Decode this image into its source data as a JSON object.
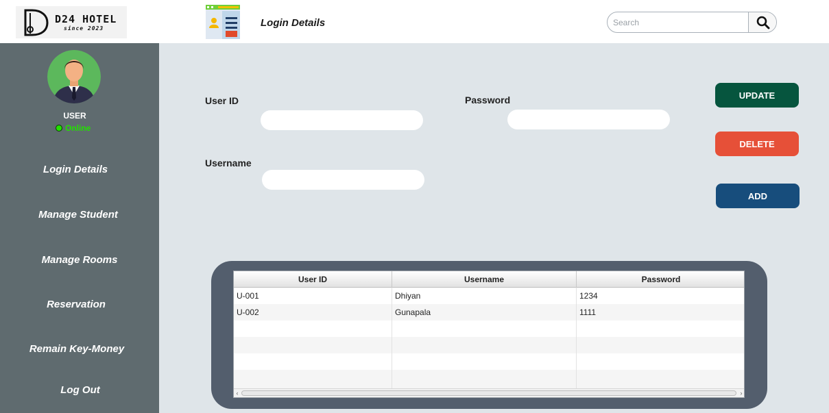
{
  "brand": {
    "name": "D24 HOTEL",
    "tagline": "since 2023"
  },
  "header": {
    "title": "Login Details",
    "search": {
      "placeholder": "Search",
      "value": ""
    }
  },
  "sidebar": {
    "user_label": "USER",
    "status": "Online",
    "items": [
      {
        "label": "Login Details"
      },
      {
        "label": "Manage Student"
      },
      {
        "label": "Manage Rooms"
      },
      {
        "label": "Reservation"
      },
      {
        "label": "Remain Key-Money"
      },
      {
        "label": "Log Out"
      }
    ]
  },
  "form": {
    "user_id": {
      "label": "User ID",
      "value": ""
    },
    "password": {
      "label": "Password",
      "value": ""
    },
    "username": {
      "label": "Username",
      "value": ""
    }
  },
  "buttons": {
    "update": "UPDATE",
    "delete": "DELETE",
    "add": "ADD"
  },
  "colors": {
    "update": "#06553e",
    "delete": "#e65038",
    "add": "#174d7c",
    "sidebar": "#5f6b6f",
    "status": "#22e000"
  },
  "table": {
    "columns": [
      "User ID",
      "Username",
      "Password"
    ],
    "rows": [
      [
        "U-001",
        "Dhiyan",
        "1234"
      ],
      [
        "U-002",
        "Gunapala",
        "1111"
      ]
    ]
  }
}
